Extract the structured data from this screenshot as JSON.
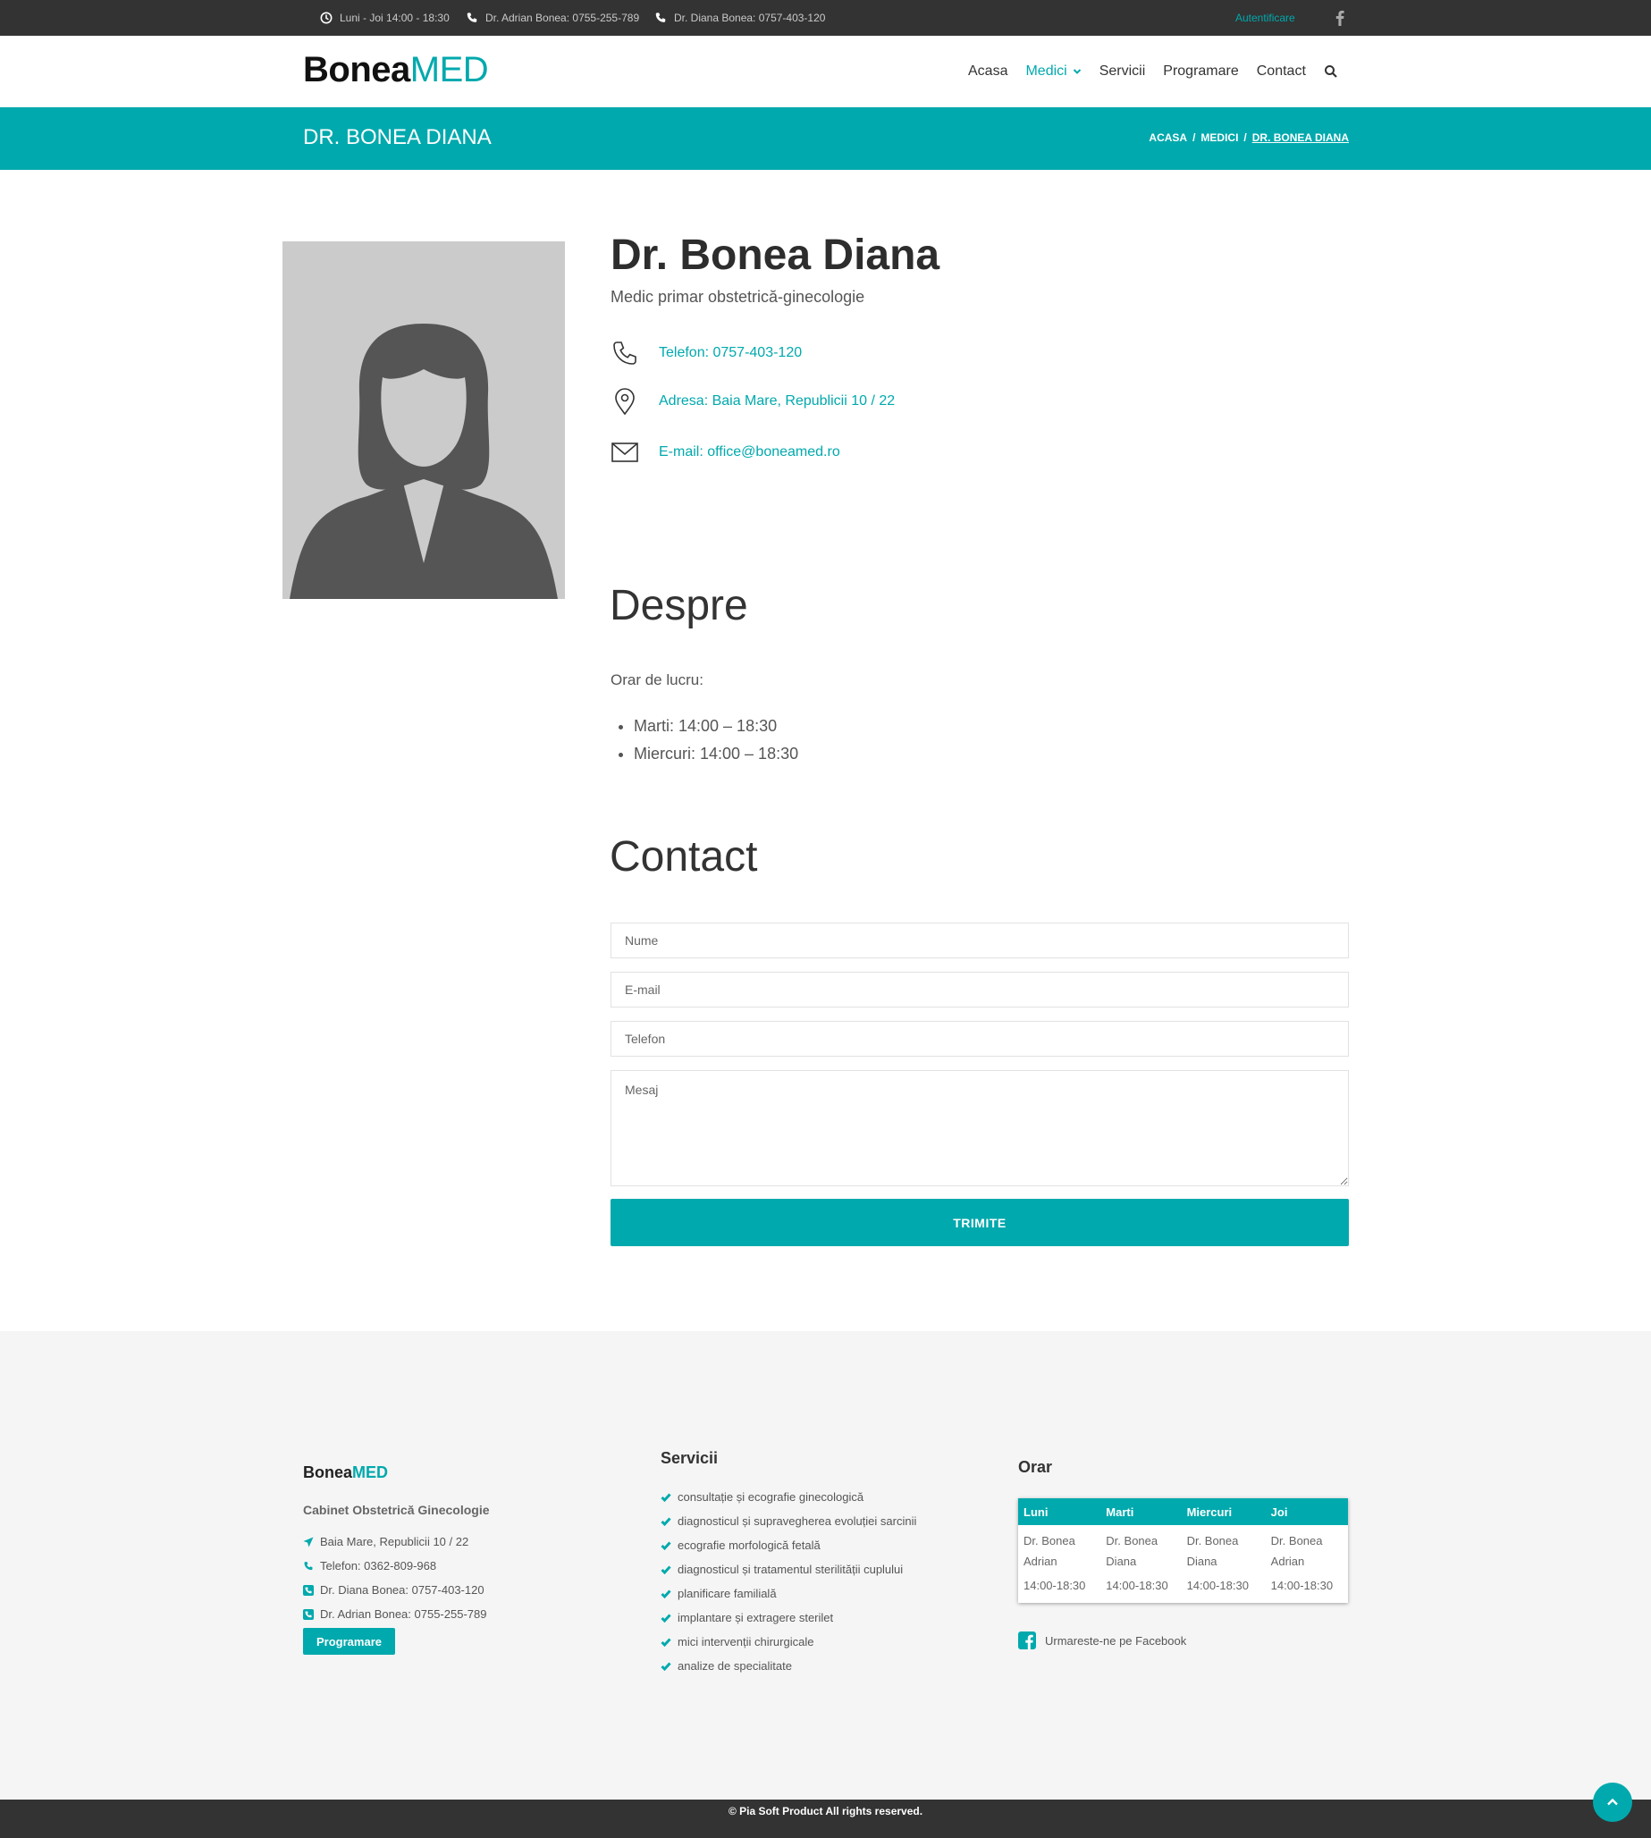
{
  "topbar": {
    "hours": "Luni - Joi 14:00 - 18:30",
    "phone_adrian": "Dr. Adrian Bonea: 0755-255-789",
    "phone_diana": "Dr. Diana Bonea: 0757-403-120",
    "login": "Autentificare"
  },
  "brand": {
    "name": "Bonea",
    "accent": "MED"
  },
  "nav": [
    "Acasa",
    "Medici",
    "Servicii",
    "Programare",
    "Contact"
  ],
  "page_title": "DR. BONEA DIANA",
  "breadcrumb": [
    "ACASA",
    "MEDICI",
    "DR. BONEA DIANA"
  ],
  "breadcrumb_sep": "/",
  "doctor": {
    "name": "Dr. Bonea Diana",
    "title": "Medic primar obstetrică-ginecologie",
    "phone": "Telefon: 0757-403-120",
    "address": "Adresa: Baia Mare, Republicii 10 / 22",
    "email": "E-mail: office@boneamed.ro"
  },
  "about": {
    "heading": "Despre",
    "schedule_label": "Orar de lucru:",
    "schedule": [
      "Marti: 14:00 – 18:30",
      "Miercuri: 14:00 – 18:30"
    ]
  },
  "contact_form": {
    "heading": "Contact",
    "name_placeholder": "Nume",
    "email_placeholder": "E-mail",
    "phone_placeholder": "Telefon",
    "message_placeholder": "Mesaj",
    "submit": "TRIMITE"
  },
  "footer": {
    "brand": {
      "name": "Bonea",
      "accent": "MED"
    },
    "subtitle": "Cabinet Obstetrică Ginecologie",
    "address": "Baia Mare, Republicii 10 / 22",
    "phone": "Telefon: 0362-809-968",
    "diana": "Dr. Diana Bonea: 0757-403-120",
    "adrian": "Dr. Adrian Bonea: 0755-255-789",
    "appointment_button": "Programare",
    "services_heading": "Servicii",
    "services": [
      "consultație și ecografie ginecologică",
      "diagnosticul și supravegherea evoluției sarcinii",
      "ecografie morfologică fetală",
      "diagnosticul și tratamentul sterilității cuplului",
      "planificare familială",
      "implantare și extragere sterilet",
      "mici intervenții chirurgicale",
      "analize de specialitate"
    ],
    "orar_heading": "Orar",
    "orar_days": [
      "Luni",
      "Marti",
      "Miercuri",
      "Joi"
    ],
    "orar_doctors": [
      "Dr. Bonea Adrian",
      "Dr. Bonea Diana",
      "Dr. Bonea Diana",
      "Dr. Bonea Adrian"
    ],
    "orar_hours": [
      "14:00-18:30",
      "14:00-18:30",
      "14:00-18:30",
      "14:00-18:30"
    ],
    "facebook_follow": "Urmareste-ne pe Facebook"
  },
  "copyright": "© Pia Soft Product All rights reserved.",
  "colors": {
    "accent": "#00a9ad",
    "dark_bar": "#333333",
    "footer_bg": "#f5f5f5"
  },
  "icons": [
    "clock-icon",
    "phone-icon",
    "facebook-icon",
    "chevron-down-icon",
    "search-icon",
    "map-pin-icon",
    "mail-icon",
    "send-icon",
    "check-icon",
    "chevron-up-icon"
  ]
}
